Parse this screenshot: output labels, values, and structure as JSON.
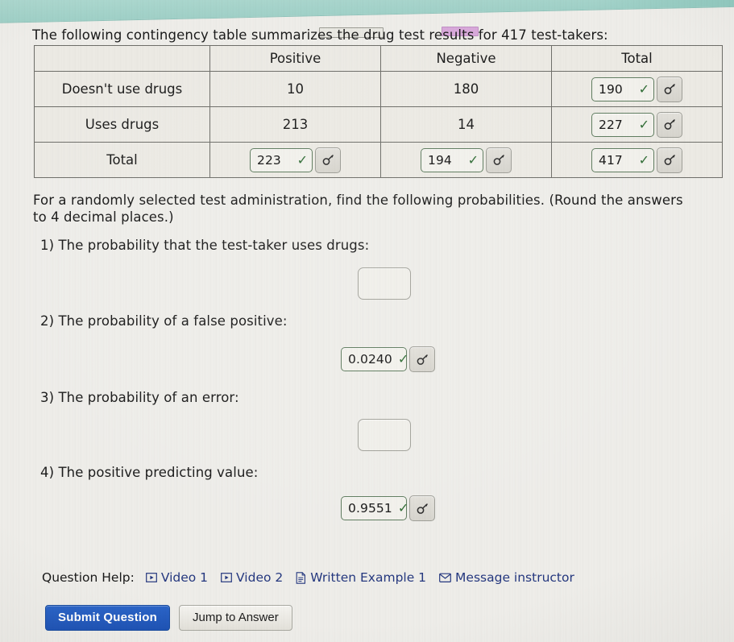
{
  "window": {
    "top_band_color": "#a9d6cd",
    "background_color": "#eeede9"
  },
  "intro_text": "The following contingency table summarizes the drug test results for 417 test-takers:",
  "table": {
    "headers": [
      "",
      "Positive",
      "Negative",
      "Total"
    ],
    "rows": [
      {
        "label": "Doesn't use drugs",
        "cells": [
          {
            "type": "text",
            "value": "10"
          },
          {
            "type": "text",
            "value": "180"
          },
          {
            "type": "input",
            "value": "190",
            "status": "correct"
          }
        ]
      },
      {
        "label": "Uses drugs",
        "cells": [
          {
            "type": "text",
            "value": "213"
          },
          {
            "type": "text",
            "value": "14"
          },
          {
            "type": "input",
            "value": "227",
            "status": "correct"
          }
        ]
      },
      {
        "label": "Total",
        "cells": [
          {
            "type": "input",
            "value": "223",
            "status": "correct"
          },
          {
            "type": "input",
            "value": "194",
            "status": "correct"
          },
          {
            "type": "input",
            "value": "417",
            "status": "correct"
          }
        ]
      }
    ]
  },
  "instructions": "For a randomly selected test administration, find the following probabilities. (Round the answers to 4 decimal places.)",
  "questions": [
    {
      "number": "1)",
      "prompt": "1) The probability that the test-taker uses drugs:",
      "answer": "",
      "status": "empty"
    },
    {
      "number": "2)",
      "prompt": "2) The probability of a false positive:",
      "answer": "0.0240",
      "status": "correct"
    },
    {
      "number": "3)",
      "prompt": "3) The probability of an error:",
      "answer": "",
      "status": "empty"
    },
    {
      "number": "4)",
      "prompt": "4) The positive predicting value:",
      "answer": "0.9551",
      "status": "correct"
    }
  ],
  "question_help": {
    "label": "Question Help:",
    "links": [
      {
        "icon": "video-icon",
        "label": "Video 1"
      },
      {
        "icon": "video-icon",
        "label": "Video 2"
      },
      {
        "icon": "document-icon",
        "label": "Written Example 1"
      },
      {
        "icon": "envelope-icon",
        "label": "Message instructor"
      }
    ],
    "link_color": "#23367e"
  },
  "buttons": {
    "submit": "Submit Question",
    "jump": "Jump to Answer",
    "submit_color": "#1d52b5"
  },
  "icons": {
    "check": "✓",
    "key": "key-icon"
  }
}
